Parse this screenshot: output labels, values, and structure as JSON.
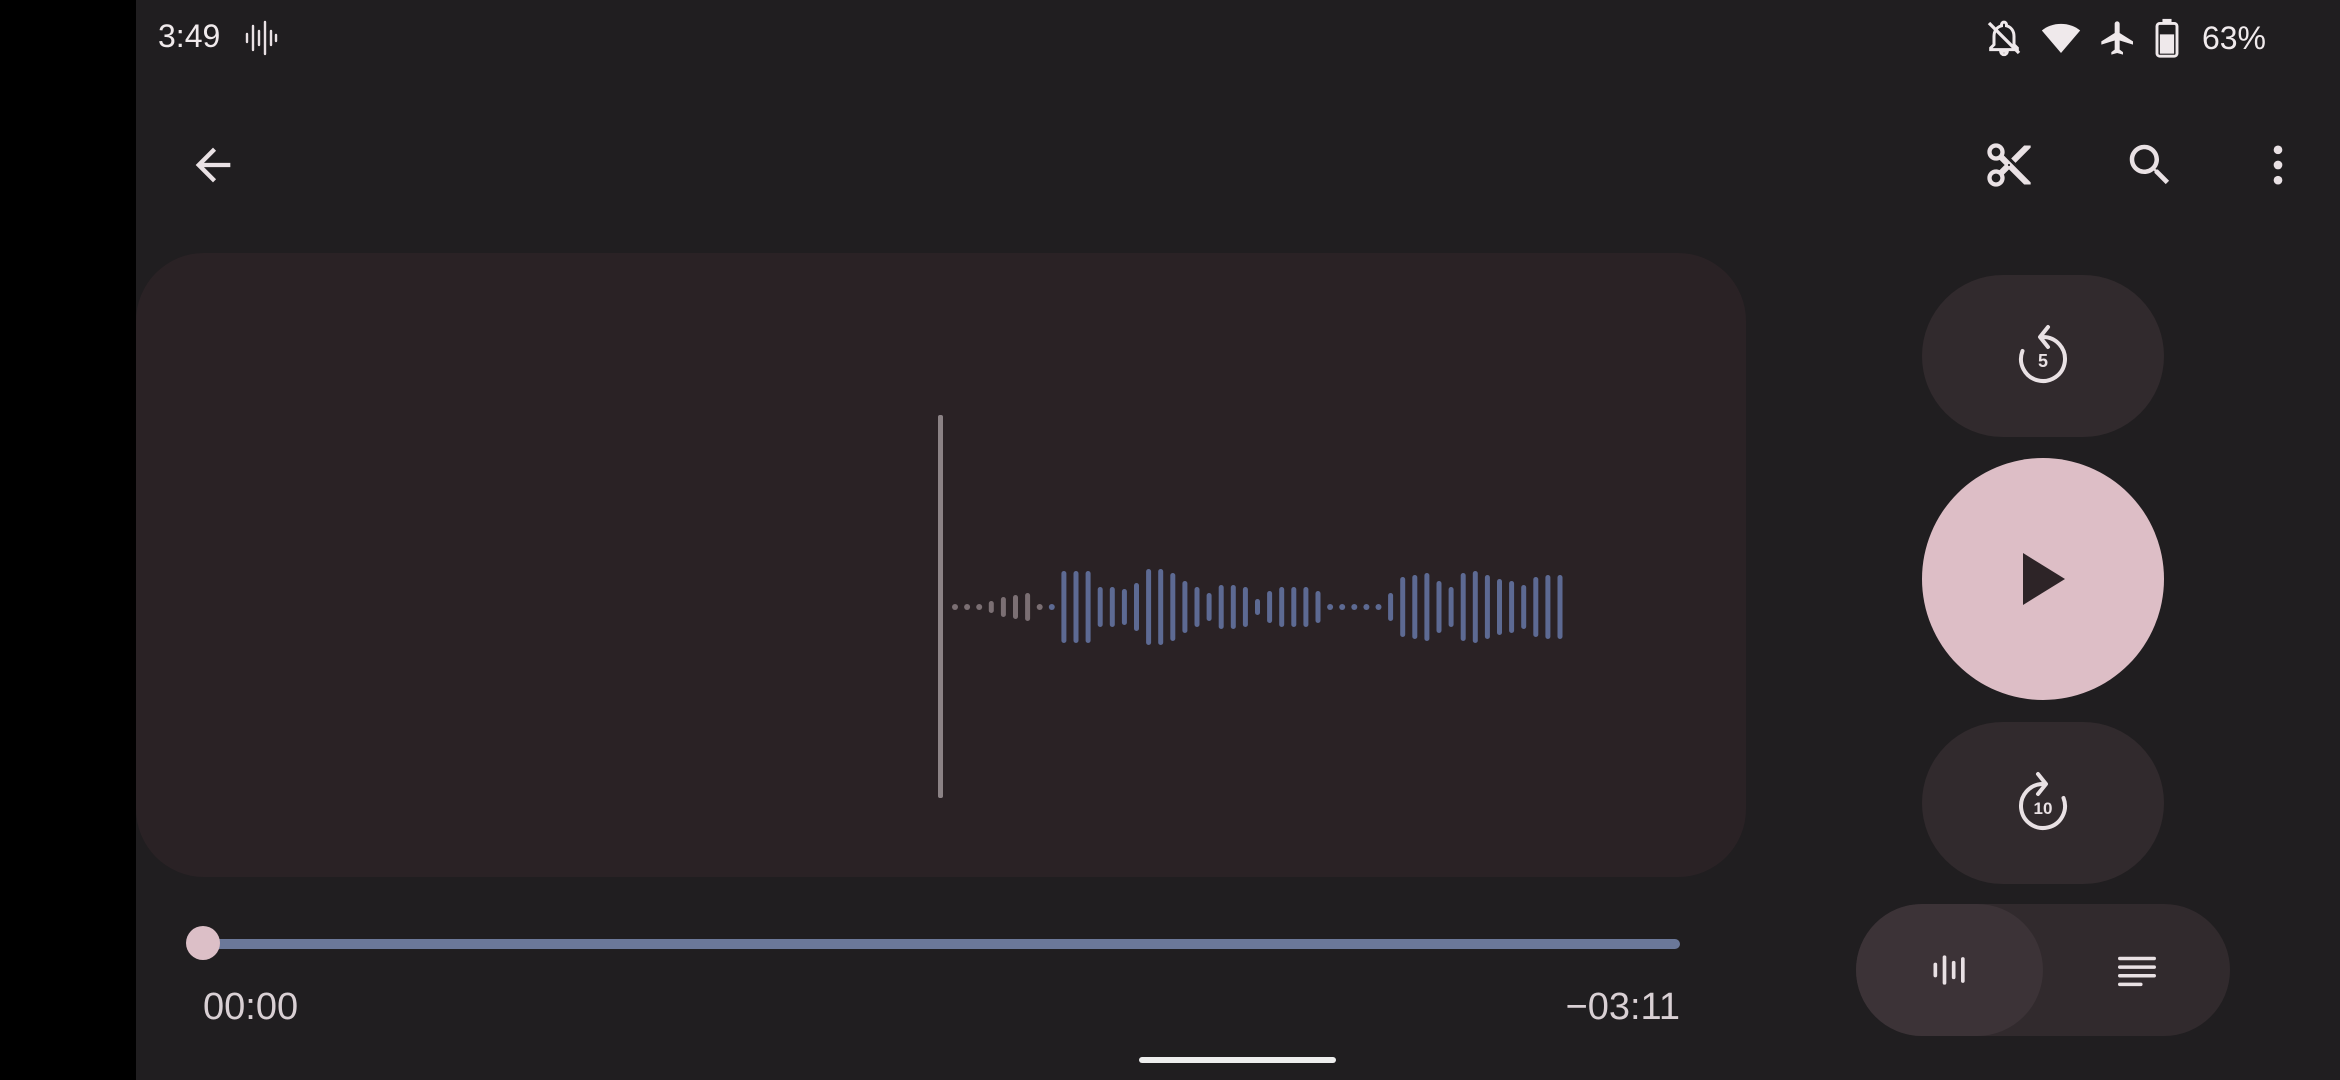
{
  "status_bar": {
    "time": "3:49",
    "battery_percent": "63%",
    "icons": [
      "recorder-icon",
      "bell-off-icon",
      "wifi-icon",
      "airplane-icon",
      "battery-icon"
    ]
  },
  "toolbar": {
    "back": "back-icon",
    "actions": [
      "scissors-icon",
      "search-icon",
      "more-vert-icon"
    ]
  },
  "controls": {
    "rewind_seconds": "5",
    "forward_seconds": "10",
    "play": "play-icon"
  },
  "view_toggle": {
    "options": [
      "waveform-icon",
      "transcript-icon"
    ],
    "selected": "waveform-icon"
  },
  "playback": {
    "current_time": "00:00",
    "remaining_time": "−03:11",
    "progress": 0
  },
  "colors": {
    "background": "#201e20",
    "card": "#2a2225",
    "accent": "#ddbec6",
    "waveform_future": "#5d6a93",
    "waveform_past": "#7b6f73",
    "seek_track": "#6b7899"
  }
}
